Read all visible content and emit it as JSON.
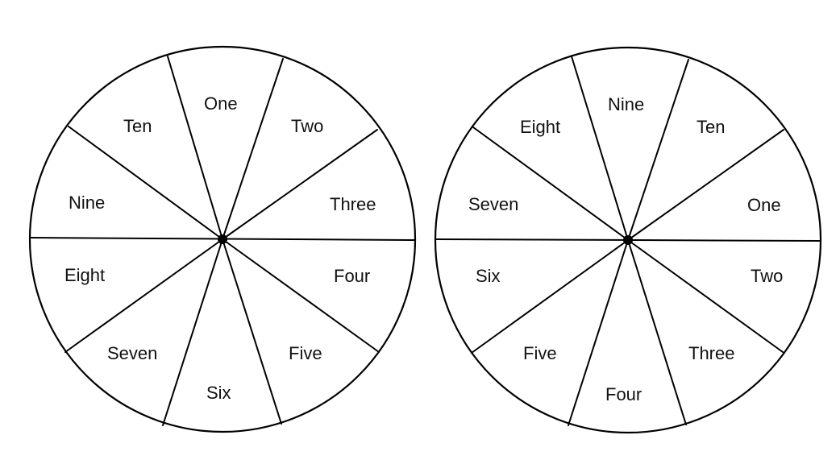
{
  "colors": {
    "background": "#ffffff",
    "ink": "#000000"
  },
  "wheels": [
    {
      "name": "left-wheel",
      "labels": [
        "One",
        "Two",
        "Three",
        "Four",
        "Five",
        "Six",
        "Seven",
        "Eight",
        "Nine",
        "Ten"
      ]
    },
    {
      "name": "right-wheel",
      "labels": [
        "Nine",
        "Ten",
        "One",
        "Two",
        "Three",
        "Four",
        "Five",
        "Six",
        "Seven",
        "Eight"
      ]
    }
  ]
}
